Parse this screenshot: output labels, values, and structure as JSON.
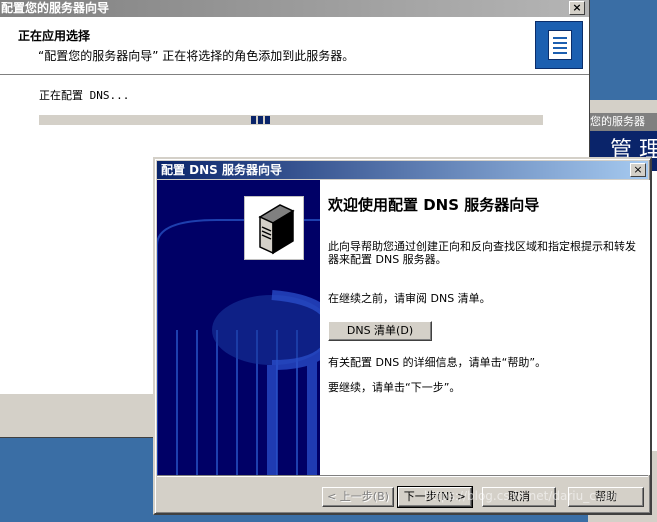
{
  "background": {
    "right_window_title": "您的服务器",
    "right_window_banner": "管 理"
  },
  "main_wizard": {
    "title": "配置您的服务器向导",
    "close_label": "×",
    "header_title": "正在应用选择",
    "header_subtitle": "“配置您的服务器向导” 正在将选择的角色添加到此服务器。",
    "status_text": "正在配置 DNS...",
    "progress_fraction": 0.42,
    "header_icon": "server-wizard-icon"
  },
  "dns_wizard": {
    "title": "配置 DNS 服务器向导",
    "close_label": "×",
    "heading": "欢迎使用配置 DNS 服务器向导",
    "description": "此向导帮助您通过创建正向和反向查找区域和指定根提示和转发器来配置 DNS 服务器。",
    "review_text": "在继续之前，请审阅 DNS 清单。",
    "checklist_button": "DNS 清单(D)",
    "help_text": "有关配置 DNS 的详细信息，请单击“帮助”。",
    "next_text": "要继续，请单击“下一步”。",
    "buttons": {
      "back": "< 上一步(B)",
      "next": "下一步(N) >",
      "cancel": "取消",
      "help": "帮助"
    },
    "side_icon": "dns-server-icon"
  },
  "watermark": "https://blog.csdn.net/dariu_csdn",
  "colors": {
    "active_title": "#0a246a",
    "inactive_title": "#808080",
    "desktop": "#3a6ea5",
    "side_panel": "#000066"
  }
}
